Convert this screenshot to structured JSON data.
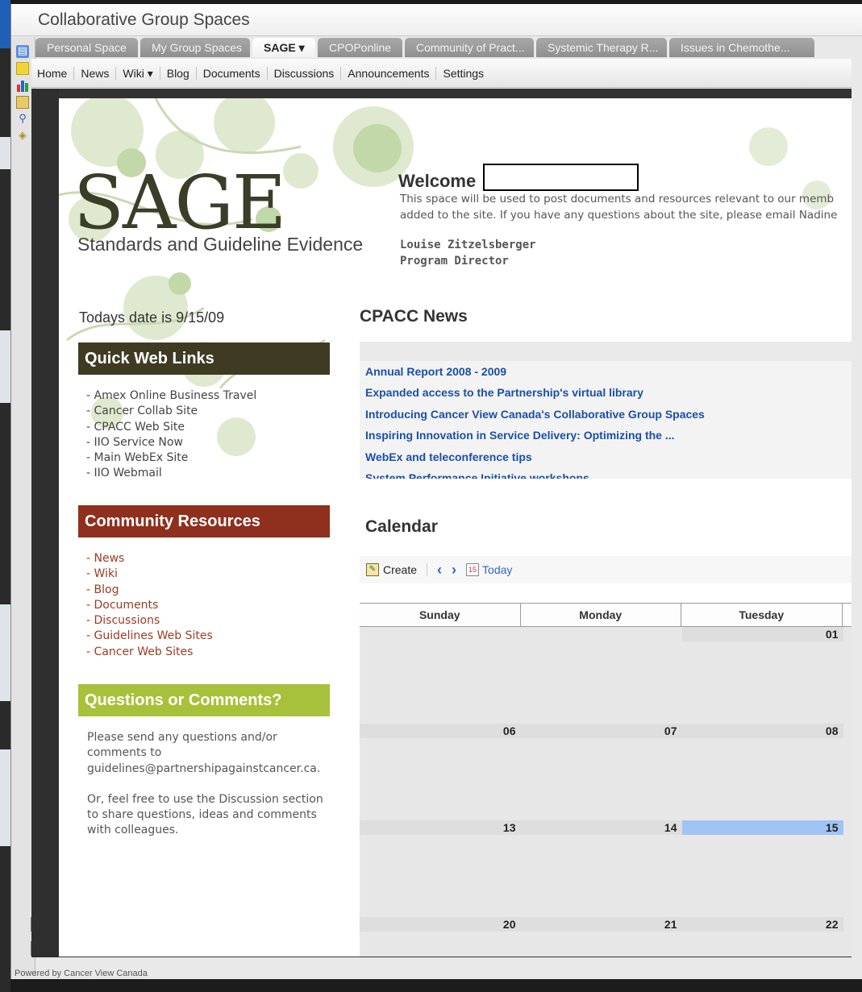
{
  "app": {
    "title": "Collaborative Group Spaces",
    "footer": "Powered by Cancer View Canada"
  },
  "toolbar_icons": [
    "page-icon",
    "note-icon",
    "chart-icon",
    "folder-icon",
    "search-icon",
    "tag-icon"
  ],
  "tabs": [
    {
      "label": "Personal Space",
      "active": false
    },
    {
      "label": "My Group Spaces",
      "active": false
    },
    {
      "label": "SAGE ▾",
      "active": true
    },
    {
      "label": "CPOPonline",
      "active": false
    },
    {
      "label": "Community of Pract...",
      "active": false
    },
    {
      "label": "Systemic Therapy R...",
      "active": false
    },
    {
      "label": "Issues in Chemothe...",
      "active": false
    }
  ],
  "subnav": [
    "Home",
    "News",
    "Wiki ▾",
    "Blog",
    "Documents",
    "Discussions",
    "Announcements",
    "Settings"
  ],
  "sage": {
    "logo": "SAGE",
    "subtitle": "Standards and Guideline Evidence"
  },
  "welcome": {
    "title": "Welcome",
    "line1": "This space will be used to post documents and resources relevant to our memb",
    "line2": "added to the site. If you have any questions about the site, please email Nadine",
    "signer_name": "Louise Zitzelsberger",
    "signer_role": "Program Director"
  },
  "today": "Todays date is 9/15/09",
  "quick_links": {
    "heading": "Quick Web Links",
    "items": [
      "Amex Online Business Travel",
      "Cancer Collab Site",
      "CPACC Web Site",
      "IIO Service Now",
      "Main WebEx Site",
      "IIO Webmail"
    ]
  },
  "community": {
    "heading": "Community Resources",
    "items": [
      "News",
      "Wiki",
      "Blog",
      "Documents",
      "Discussions",
      "Guidelines Web Sites",
      "Cancer Web Sites"
    ]
  },
  "questions": {
    "heading": "Questions or Comments?",
    "p1": "Please send any questions and/or comments to guidelines@partnershipagainstcancer.ca.",
    "p2": "Or, feel free to use the Discussion section to share questions, ideas and comments with colleagues."
  },
  "news": {
    "heading": "CPACC News",
    "items": [
      "Annual Report 2008 - 2009",
      "Expanded access to the Partnership's virtual library",
      "Introducing Cancer View Canada's Collaborative Group Spaces",
      "Inspiring Innovation in Service Delivery: Optimizing the ...",
      "WebEx and teleconference tips",
      "System Performance Initiative workshops"
    ]
  },
  "calendar": {
    "heading": "Calendar",
    "create_label": "Create",
    "today_label": "Today",
    "days": [
      "Sunday",
      "Monday",
      "Tuesday"
    ],
    "weeks": [
      [
        "",
        "",
        "01"
      ],
      [
        "06",
        "07",
        "08"
      ],
      [
        "13",
        "14",
        "15"
      ],
      [
        "20",
        "21",
        "22"
      ]
    ],
    "highlight_color": "#9fc4f4"
  },
  "colors": {
    "links_panel": "#3f3b23",
    "resources_panel": "#8f2f1d",
    "questions_panel": "#a8c13a",
    "news_link": "#1b4fa6"
  }
}
